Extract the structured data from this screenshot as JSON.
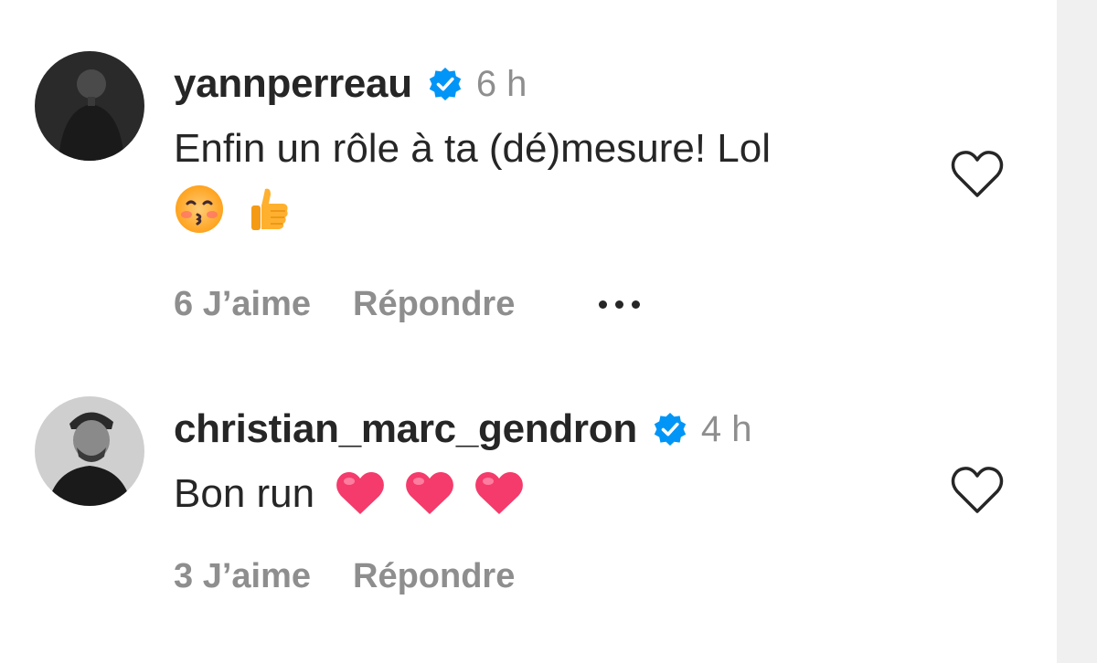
{
  "comments": [
    {
      "username": "yannperreau",
      "verified": true,
      "time": "6 h",
      "text": "Enfin un rôle à ta (dé)mesure! Lol",
      "emojis": [
        "kissing-face-emoji",
        "thumbs-up-emoji"
      ],
      "likes_label": "6 J’aime",
      "reply_label": "Répondre",
      "has_more_menu": true
    },
    {
      "username": "christian_marc_gendron",
      "verified": true,
      "time": "4 h",
      "text": "Bon run",
      "emojis": [
        "red-heart-emoji",
        "red-heart-emoji",
        "red-heart-emoji"
      ],
      "likes_label": "3 J’aime",
      "reply_label": "Répondre",
      "has_more_menu": false
    }
  ],
  "colors": {
    "text_primary": "#262626",
    "text_secondary": "#8e8e8e",
    "verified_blue": "#0095f6",
    "heart_outline": "#262626"
  }
}
